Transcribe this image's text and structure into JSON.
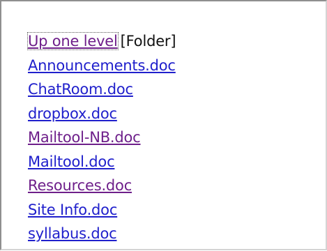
{
  "listing": {
    "up_link": {
      "label": "Up one level",
      "suffix": "[Folder]"
    },
    "files": [
      {
        "label": "Announcements.doc",
        "visited": false
      },
      {
        "label": "ChatRoom.doc",
        "visited": false
      },
      {
        "label": "dropbox.doc",
        "visited": false
      },
      {
        "label": "Mailtool-NB.doc",
        "visited": true
      },
      {
        "label": "Mailtool.doc",
        "visited": false
      },
      {
        "label": "Resources.doc",
        "visited": true
      },
      {
        "label": "Site Info.doc",
        "visited": false
      },
      {
        "label": "syllabus.doc",
        "visited": false
      }
    ]
  },
  "colors": {
    "link": "#2020cc",
    "visited_link": "#6e1f8a",
    "text": "#111111",
    "background": "#ffffff"
  }
}
